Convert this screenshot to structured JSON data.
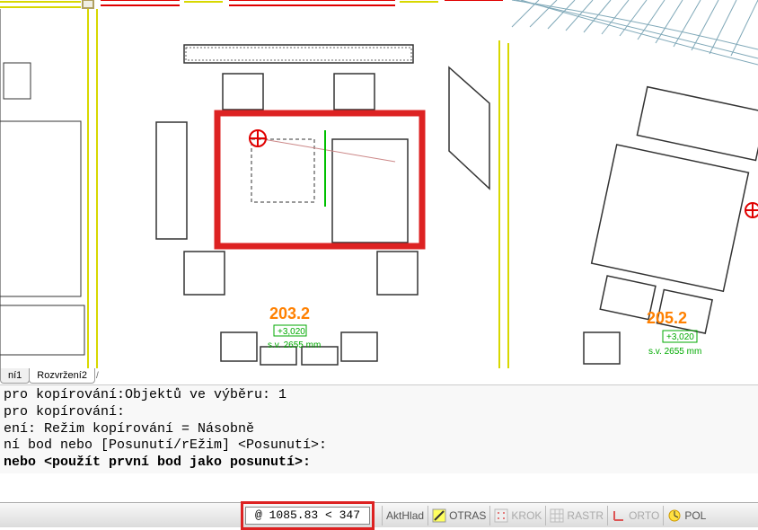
{
  "tabs": {
    "t1_partial": "ní1",
    "t2": "Rozvržení2"
  },
  "command_lines": [
    " pro kopírování:Objektů ve výběru: 1",
    " pro kopírování:",
    "ení:  Režim kopírování = Násobně",
    "ní bod nebo [Posunutí/rEžim] <Posunutí>:"
  ],
  "command_prompt": " nebo <použít první bod jako posunutí>:",
  "coord_input": "@ 1085.83 < 347",
  "status_buttons": {
    "akthlad": "AktHlad",
    "otras": "OTRAS",
    "krok": "KROK",
    "rastr": "RASTR",
    "orto": "ORTO",
    "pol": "POL"
  },
  "rooms": {
    "r1": {
      "label": "203.2",
      "dim_top": "+3,020",
      "dim_bottom": "s.v. 2655 mm"
    },
    "r2": {
      "label": "205.2",
      "dim_top": "+3,020",
      "dim_bottom": "s.v. 2655 mm"
    }
  },
  "colors": {
    "highlight": "#d22",
    "room_num": "#ff8000",
    "dim": "#00aa00",
    "ceiling": "#c0d8e0",
    "wall_yellow": "#d8d800",
    "wall_red": "#e00000"
  }
}
